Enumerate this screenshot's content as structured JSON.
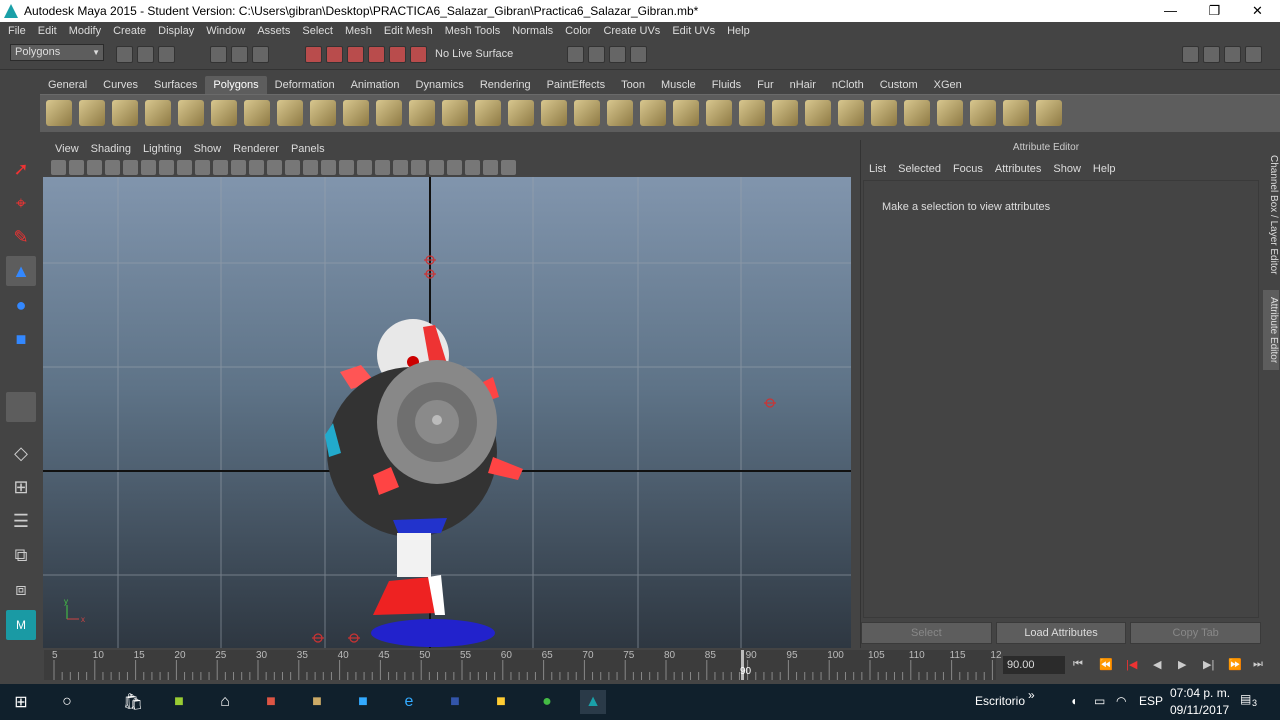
{
  "title": "Autodesk Maya 2015 - Student Version: C:\\Users\\gibran\\Desktop\\PRACTICA6_Salazar_Gibran\\Practica6_Salazar_Gibran.mb*",
  "window_controls": {
    "minimize": "—",
    "restore": "❐",
    "close": "✕"
  },
  "menubar": [
    "File",
    "Edit",
    "Modify",
    "Create",
    "Display",
    "Window",
    "Assets",
    "Select",
    "Mesh",
    "Edit Mesh",
    "Mesh Tools",
    "Normals",
    "Color",
    "Create UVs",
    "Edit UVs",
    "Help"
  ],
  "status": {
    "mode": "Polygons",
    "live_surface": "No Live Surface"
  },
  "shelf_tabs": [
    "General",
    "Curves",
    "Surfaces",
    "Polygons",
    "Deformation",
    "Animation",
    "Dynamics",
    "Rendering",
    "PaintEffects",
    "Toon",
    "Muscle",
    "Fluids",
    "Fur",
    "nHair",
    "nCloth",
    "Custom",
    "XGen"
  ],
  "active_shelf": "Polygons",
  "viewport_menu": [
    "View",
    "Shading",
    "Lighting",
    "Show",
    "Renderer",
    "Panels"
  ],
  "attribute_editor": {
    "title": "Attribute Editor",
    "menu": [
      "List",
      "Selected",
      "Focus",
      "Attributes",
      "Show",
      "Help"
    ],
    "message": "Make a selection to view attributes",
    "buttons": {
      "select": "Select",
      "load": "Load Attributes",
      "copy": "Copy Tab"
    }
  },
  "side_tabs": {
    "channel": "Channel Box / Layer Editor",
    "attribute": "Attribute Editor"
  },
  "timeline": {
    "ticks": [
      "5",
      "10",
      "15",
      "20",
      "25",
      "30",
      "35",
      "40",
      "45",
      "50",
      "55",
      "60",
      "65",
      "70",
      "75",
      "80",
      "85",
      "90",
      "95",
      "100",
      "105",
      "110",
      "115",
      "12"
    ],
    "current_frame": "90.00",
    "current_marker": "90"
  },
  "taskbar": {
    "desk_label": "Escritorio",
    "language": "ESP",
    "time": "07:04 p. m.",
    "date": "09/11/2017",
    "notifications": "3"
  },
  "axis": {
    "x": "x",
    "y": "y"
  }
}
